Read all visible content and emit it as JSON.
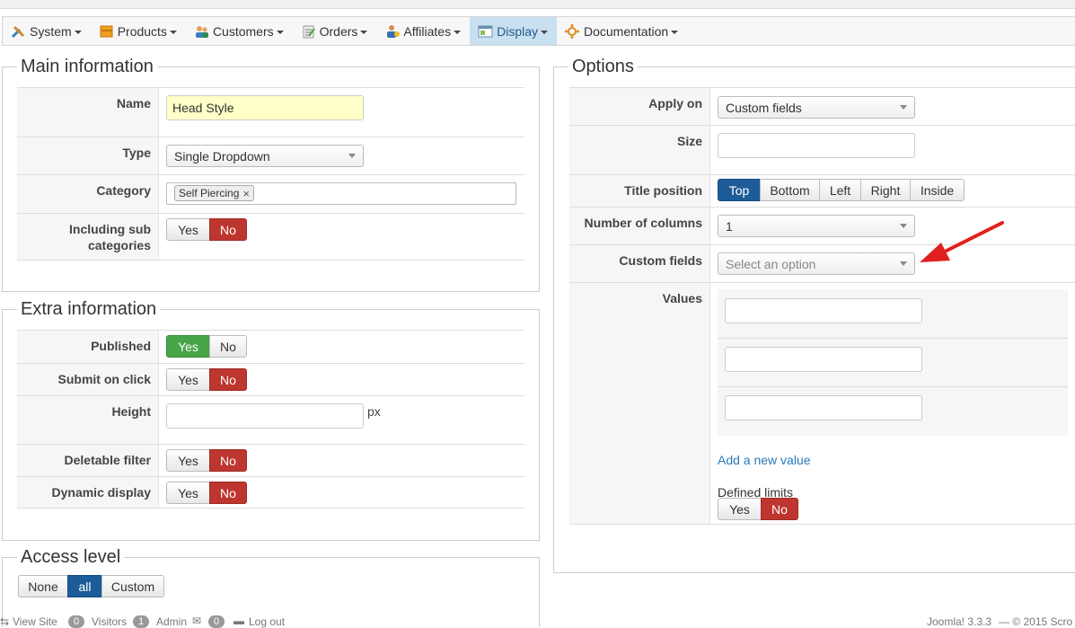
{
  "menu": {
    "items": [
      {
        "label": "System",
        "icon": "tools-icon"
      },
      {
        "label": "Products",
        "icon": "box-icon"
      },
      {
        "label": "Customers",
        "icon": "users-icon"
      },
      {
        "label": "Orders",
        "icon": "orders-icon"
      },
      {
        "label": "Affiliates",
        "icon": "affiliates-icon"
      },
      {
        "label": "Display",
        "icon": "display-icon",
        "active": true
      },
      {
        "label": "Documentation",
        "icon": "documentation-icon"
      }
    ]
  },
  "main_info": {
    "legend": "Main information",
    "name_label": "Name",
    "name_value": "Head Style",
    "type_label": "Type",
    "type_value": "Single Dropdown",
    "category_label": "Category",
    "category_tag": "Self Piercing",
    "tag_remove": "×",
    "subcat_label_1": "Including sub",
    "subcat_label_2": "categories",
    "yes": "Yes",
    "no": "No"
  },
  "extra_info": {
    "legend": "Extra information",
    "published_label": "Published",
    "submit_label": "Submit on click",
    "height_label": "Height",
    "height_unit": "px",
    "deletable_label": "Deletable filter",
    "dynamic_label": "Dynamic display",
    "yes": "Yes",
    "no": "No"
  },
  "access": {
    "legend": "Access level",
    "options": [
      "None",
      "all",
      "Custom"
    ]
  },
  "options": {
    "legend": "Options",
    "apply_label": "Apply on",
    "apply_value": "Custom fields",
    "size_label": "Size",
    "title_pos_label": "Title position",
    "title_pos_options": [
      "Top",
      "Bottom",
      "Left",
      "Right",
      "Inside"
    ],
    "columns_label": "Number of columns",
    "columns_value": "1",
    "custom_fields_label": "Custom fields",
    "custom_fields_placeholder": "Select an option",
    "values_label": "Values",
    "add_value": "Add a new value",
    "defined_limits": "Defined limits",
    "yes": "Yes",
    "no": "No"
  },
  "footer": {
    "view_site": "View Site",
    "visitors_count": "0",
    "visitors": "Visitors",
    "admin_count": "1",
    "admin": "Admin",
    "messages_count": "0",
    "logout": "Log out",
    "version": "Joomla! 3.3.3",
    "copyright": "— © 2015 Scro"
  },
  "colors": {
    "accent": "#1e5c99",
    "no_red": "#bd362f",
    "yes_green": "#46a546",
    "arrow": "#e02020"
  }
}
